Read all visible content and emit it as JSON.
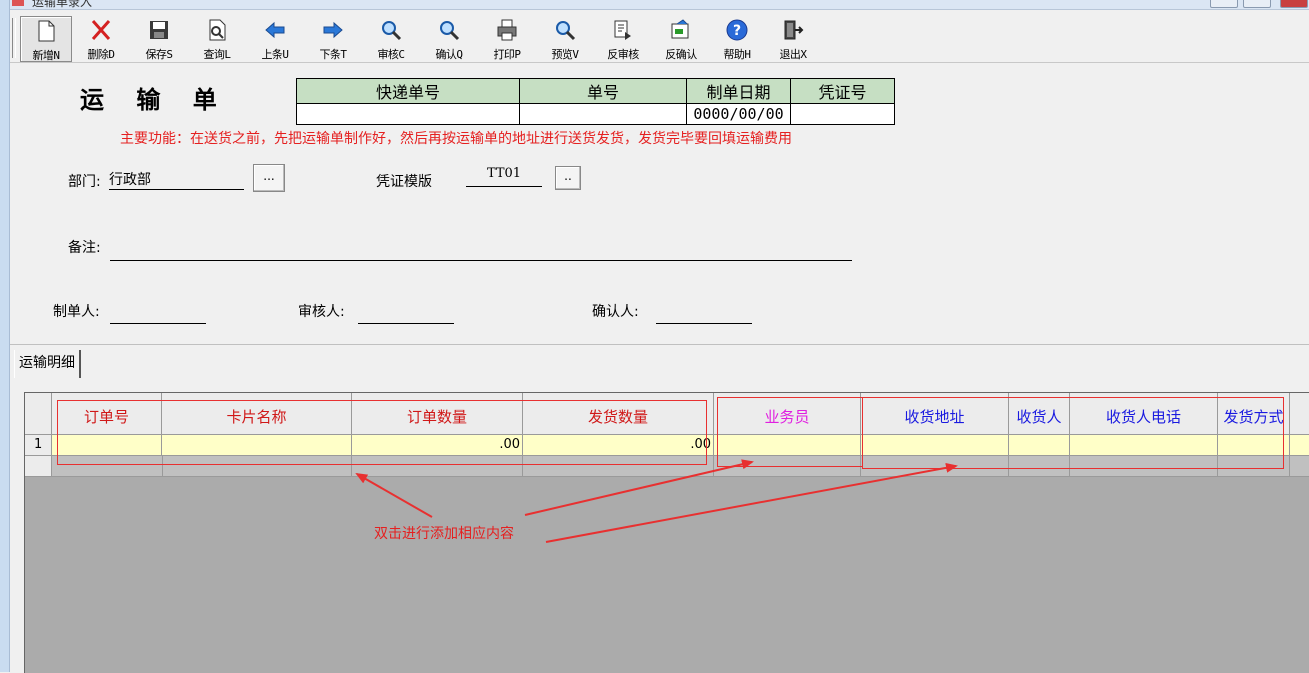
{
  "window": {
    "title": "运输单录入"
  },
  "toolbar": [
    {
      "id": "new",
      "label": "新增N",
      "icon": "new-doc-icon"
    },
    {
      "id": "delete",
      "label": "删除D",
      "icon": "delete-x-icon"
    },
    {
      "id": "save",
      "label": "保存S",
      "icon": "save-icon"
    },
    {
      "id": "query",
      "label": "查询L",
      "icon": "query-icon"
    },
    {
      "id": "prev",
      "label": "上条U",
      "icon": "arrow-left-icon"
    },
    {
      "id": "next",
      "label": "下条T",
      "icon": "arrow-right-icon"
    },
    {
      "id": "audit",
      "label": "审核C",
      "icon": "magnifier-icon"
    },
    {
      "id": "confirm",
      "label": "确认Q",
      "icon": "magnifier-icon"
    },
    {
      "id": "print",
      "label": "打印P",
      "icon": "printer-icon"
    },
    {
      "id": "preview",
      "label": "预览V",
      "icon": "magnifier-icon"
    },
    {
      "id": "unaudit",
      "label": "反审核",
      "icon": "unaudit-icon"
    },
    {
      "id": "unconfirm",
      "label": "反确认",
      "icon": "unconfirm-icon"
    },
    {
      "id": "help",
      "label": "帮助H",
      "icon": "help-icon"
    },
    {
      "id": "exit",
      "label": "退出X",
      "icon": "exit-icon"
    }
  ],
  "header": {
    "title": "运 输 单",
    "cols": [
      "快递单号",
      "单号",
      "制单日期",
      "凭证号"
    ],
    "values": [
      "",
      "",
      "0000/00/00",
      ""
    ],
    "description": "主要功能：在送货之前，先把运输单制作好，然后再按运输单的地址进行送货发货，发货完毕要回填运输费用"
  },
  "form": {
    "dept_label": "部门:",
    "dept_value": "行政部",
    "browse_label": "...",
    "template_label": "凭证模版",
    "template_value": "TT01",
    "template_browse": "..",
    "remark_label": "备注:",
    "remark_value": "",
    "maker_label": "制单人:",
    "maker_value": "",
    "auditor_label": "审核人:",
    "auditor_value": "",
    "confirmer_label": "确认人:",
    "confirmer_value": ""
  },
  "tabs": [
    {
      "label": "运输明细"
    }
  ],
  "grid": {
    "columns": [
      {
        "label": "订单号",
        "color": "#d01818"
      },
      {
        "label": "卡片名称",
        "color": "#d01818"
      },
      {
        "label": "订单数量",
        "color": "#d01818"
      },
      {
        "label": "发货数量",
        "color": "#d01818"
      },
      {
        "label": "业务员",
        "color": "#e020e0"
      },
      {
        "label": "收货地址",
        "color": "#1a1ae0"
      },
      {
        "label": "收货人",
        "color": "#1a1ae0"
      },
      {
        "label": "收货人电话",
        "color": "#1a1ae0"
      },
      {
        "label": "发货方式",
        "color": "#1a1ae0"
      }
    ],
    "rows": [
      {
        "num": "1",
        "cells": [
          "",
          "",
          ".00",
          ".00",
          "",
          "",
          "",
          "",
          ""
        ]
      }
    ]
  },
  "annotation": {
    "text": "双击进行添加相应内容",
    "color": "#e52020"
  }
}
